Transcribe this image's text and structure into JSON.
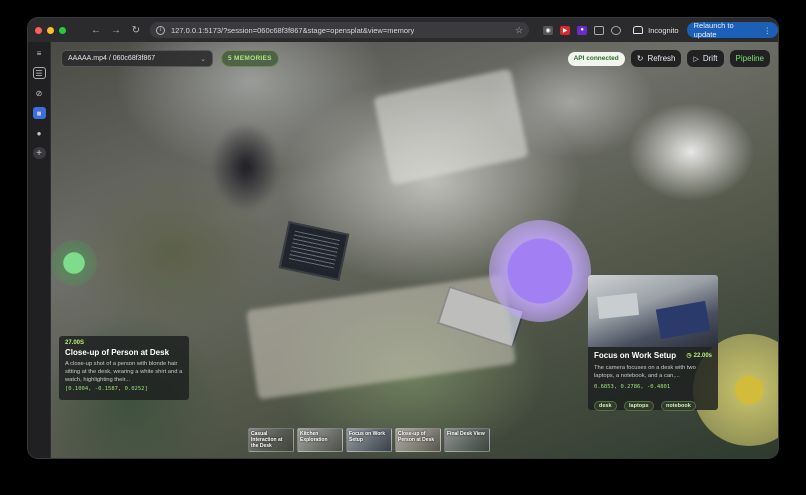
{
  "browser": {
    "url": "127.0.0.1:5173/?session=060c68f3f867&stage=opensplat&view=memory",
    "incognito_label": "Incognito",
    "relaunch_label": "Relaunch to update",
    "colors": {
      "close": "#ff5f57",
      "minimize": "#febc2e",
      "maximize": "#28c840",
      "relaunch_bg": "#1b5fb6"
    }
  },
  "rail": {
    "items": [
      {
        "icon": "sidebar-toggle-icon"
      },
      {
        "icon": "layers-icon"
      },
      {
        "icon": "circle-slash-icon"
      },
      {
        "icon": "app-icon-blue"
      },
      {
        "icon": "person-icon"
      },
      {
        "icon": "plus-icon"
      }
    ]
  },
  "toolbar": {
    "session_value": "AAAAA.mp4 / 060c68f3f867",
    "memories_badge": "5 MEMORIES",
    "api_status": "API connected",
    "refresh_label": "Refresh",
    "drift_label": "Drift",
    "pipeline_label": "Pipeline"
  },
  "cards": {
    "left": {
      "time": "27.00S",
      "title": "Close-up of Person at Desk",
      "description": "A close-up shot of a person with blonde hair sitting at the desk, wearing a white shirt and a watch, highlighting their...",
      "coords": "[0.1004, -0.1587, 0.0252]"
    },
    "right": {
      "time": "22.00s",
      "title": "Focus on Work Setup",
      "description": "The camera focuses on a desk with two laptops, a notebook, and a can,...",
      "coords": "0.6853, 0.2786, -0.4801",
      "tags": [
        "desk",
        "laptops",
        "notebook"
      ]
    }
  },
  "thumbnails": [
    {
      "label": "Casual Interaction at the Desk"
    },
    {
      "label": "Kitchen Exploration"
    },
    {
      "label": "Focus on Work Setup"
    },
    {
      "label": "Close-up of Person at Desk"
    },
    {
      "label": "Final Desk View"
    }
  ]
}
